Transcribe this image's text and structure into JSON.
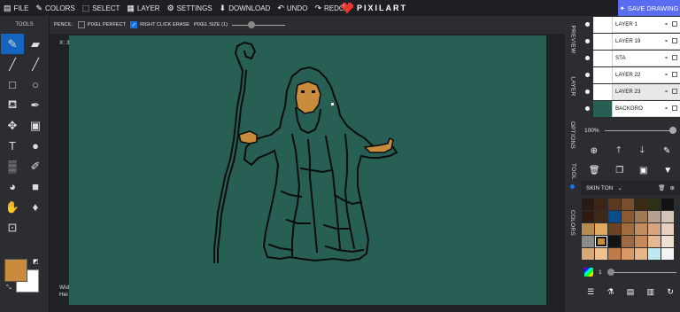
{
  "topbar": {
    "menu": [
      {
        "label": "FILE",
        "icon": "file-icon"
      },
      {
        "label": "COLORS",
        "icon": "pencil-icon"
      },
      {
        "label": "SELECT",
        "icon": "select-icon"
      },
      {
        "label": "LAYER",
        "icon": "layer-icon"
      },
      {
        "label": "SETTINGS",
        "icon": "gear-icon"
      },
      {
        "label": "DOWNLOAD",
        "icon": "download-icon"
      },
      {
        "label": "UNDO",
        "icon": "undo-icon"
      },
      {
        "label": "REDO",
        "icon": "redo-icon"
      }
    ],
    "brand": "PIXILART",
    "save_label": "SAVE DRAWING"
  },
  "tools": {
    "title": "TOOLS",
    "items": [
      {
        "name": "pencil",
        "glyph": "✎",
        "active": true
      },
      {
        "name": "eraser",
        "glyph": "▰",
        "active": false
      },
      {
        "name": "line",
        "glyph": "╱",
        "active": false
      },
      {
        "name": "line-alt",
        "glyph": "╱",
        "active": false
      },
      {
        "name": "rectangle",
        "glyph": "□",
        "active": false
      },
      {
        "name": "circle",
        "glyph": "○",
        "active": false
      },
      {
        "name": "bucket",
        "glyph": "⛾",
        "active": false
      },
      {
        "name": "dropper",
        "glyph": "✒",
        "active": false
      },
      {
        "name": "move",
        "glyph": "✥",
        "active": false
      },
      {
        "name": "fill-shade",
        "glyph": "▣",
        "active": false
      },
      {
        "name": "text",
        "glyph": "T",
        "active": false
      },
      {
        "name": "mouse",
        "glyph": "●",
        "active": false
      },
      {
        "name": "dither",
        "glyph": "▒",
        "active": false
      },
      {
        "name": "smudge",
        "glyph": "✐",
        "active": false
      },
      {
        "name": "color-replace",
        "glyph": "◕",
        "active": false
      },
      {
        "name": "gradient",
        "glyph": "■",
        "active": false
      },
      {
        "name": "hand",
        "glyph": "✋",
        "active": false
      },
      {
        "name": "drop",
        "glyph": "♦",
        "active": false
      },
      {
        "name": "resize",
        "glyph": "⊡",
        "active": false
      }
    ],
    "primary_color": "#c98c3c",
    "secondary_color": "#ffffff"
  },
  "options": {
    "tool_label": "PENCIL:",
    "pixel_perfect": "PIXEL PERFECT",
    "pixel_perfect_on": false,
    "right_click_erase": "RIGHT CLICK ERASE",
    "right_click_erase_on": true,
    "pixel_size": "PIXEL SIZE (1)"
  },
  "canvas": {
    "coord": "X: 3",
    "info_line1": "Wid",
    "info_line2": "Hei",
    "bg_color": "#285f54"
  },
  "vtabs": [
    "PREVIEW",
    "LAYER",
    "OPTIONS",
    "TOOL",
    "COLORS"
  ],
  "layers": [
    {
      "name": "LAYER 1",
      "selected": false
    },
    {
      "name": "LAYER 19",
      "selected": false
    },
    {
      "name": "STA",
      "selected": false
    },
    {
      "name": "LAYER 22",
      "selected": false
    },
    {
      "name": "LAYER 23",
      "selected": true
    },
    {
      "name": "BACKGRO",
      "selected": false
    }
  ],
  "zoom": "100%",
  "palette": {
    "name": "SKIN TON",
    "colors": [
      "#2a1a12",
      "#3b2516",
      "#5a3a22",
      "#7a4e2c",
      "#3a2a14",
      "#2c3016",
      "#121212",
      "#2e1c10",
      "#3d2a1a",
      "#0a4d8c",
      "#8a5a30",
      "#a07a56",
      "#b8a090",
      "#d4c4b8",
      "#b88a4c",
      "#e0a860",
      "#6a4224",
      "#a06c3c",
      "#c48c5c",
      "#d8a480",
      "#e8d0c0",
      "#8a8a8a",
      "#c98c3c",
      "#141414",
      "#a06840",
      "#c88858",
      "#e4b890",
      "#f0e0d0",
      "#d8a878",
      "#f0c090",
      "#c07c48",
      "#d89868",
      "#e8b488",
      "#bfe8f0",
      "#f4f4f4"
    ],
    "selected_index": 22,
    "brightness_value": "1"
  }
}
